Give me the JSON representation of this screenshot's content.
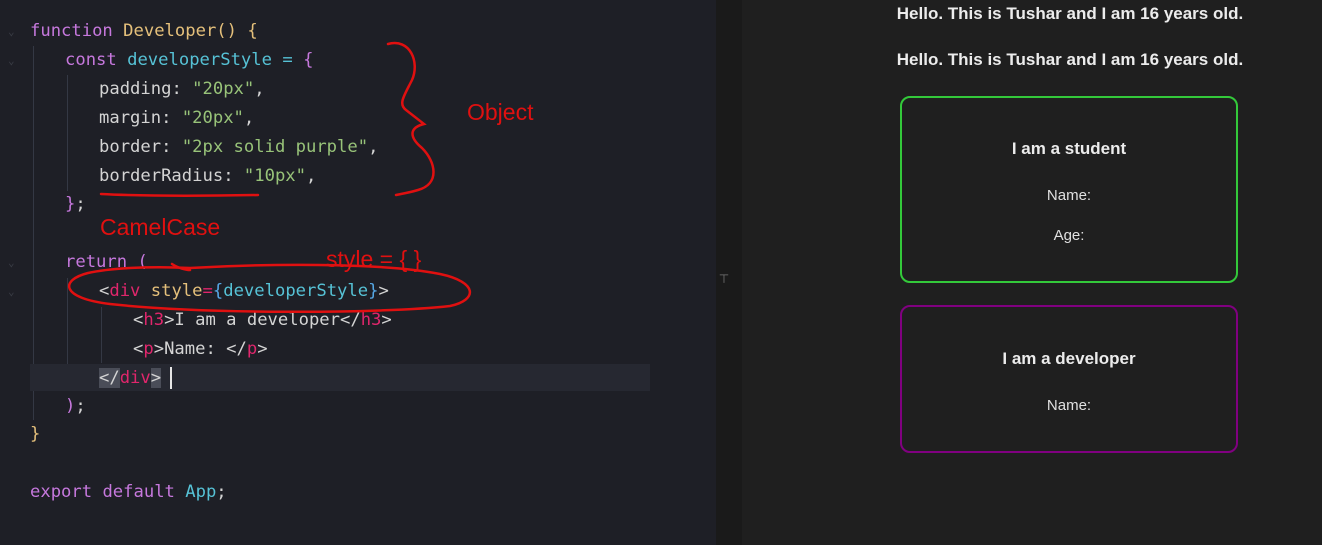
{
  "editor": {
    "lines": {
      "l1": {
        "kw": "function",
        "fn": "Developer",
        "paren": "()",
        "brace": "{"
      },
      "l2": {
        "kw": "const",
        "var": "developerStyle",
        "op": "=",
        "brace": "{"
      },
      "l3": {
        "prop": "padding",
        "colon": ":",
        "str": "\"20px\"",
        "comma": ","
      },
      "l4": {
        "prop": "margin",
        "colon": ":",
        "str": "\"20px\"",
        "comma": ","
      },
      "l5": {
        "prop": "border",
        "colon": ":",
        "str": "\"2px solid purple\"",
        "comma": ","
      },
      "l6": {
        "prop": "borderRadius",
        "colon": ":",
        "str": "\"10px\"",
        "comma": ","
      },
      "l7": {
        "brace": "}",
        "semi": ";"
      },
      "l8": {
        "kw": "return",
        "paren": "("
      },
      "l9": {
        "lt": "<",
        "tag": "div",
        "attr": "style",
        "eq": "=",
        "ob": "{",
        "val": "developerStyle",
        "cb": "}",
        "gt": ">"
      },
      "l10": {
        "lt": "<",
        "tag": "h3",
        "gt": ">",
        "text": "I am a developer",
        "close_lt": "</",
        "close_tag": "h3",
        "close_gt": ">"
      },
      "l11": {
        "lt": "<",
        "tag": "p",
        "gt": ">",
        "text": "Name: ",
        "close_lt": "</",
        "close_tag": "p",
        "close_gt": ">"
      },
      "l12": {
        "lt": "</",
        "tag": "div",
        "gt": ">"
      },
      "l13": {
        "paren": ")",
        "semi": ";"
      },
      "l14": {
        "brace": "}"
      },
      "l15": {
        "kw1": "export",
        "kw2": "default",
        "app": "App",
        "semi": ";"
      }
    }
  },
  "annotations": {
    "object_label": "Object",
    "camelcase_label": "CamelCase",
    "style_label": "style = { }",
    "ink_color": "#e01010"
  },
  "splitter": {
    "handle_icon": "⊤"
  },
  "preview": {
    "hello1": "Hello. This is Tushar and I am 16 years old.",
    "hello2": "Hello. This is Tushar and I am 16 years old.",
    "student_card": {
      "title": "I am a student",
      "name_label": "Name:",
      "age_label": "Age:",
      "border_color": "#33c93a"
    },
    "developer_card": {
      "title": "I am a developer",
      "name_label": "Name:",
      "border_color": "#800080"
    }
  }
}
